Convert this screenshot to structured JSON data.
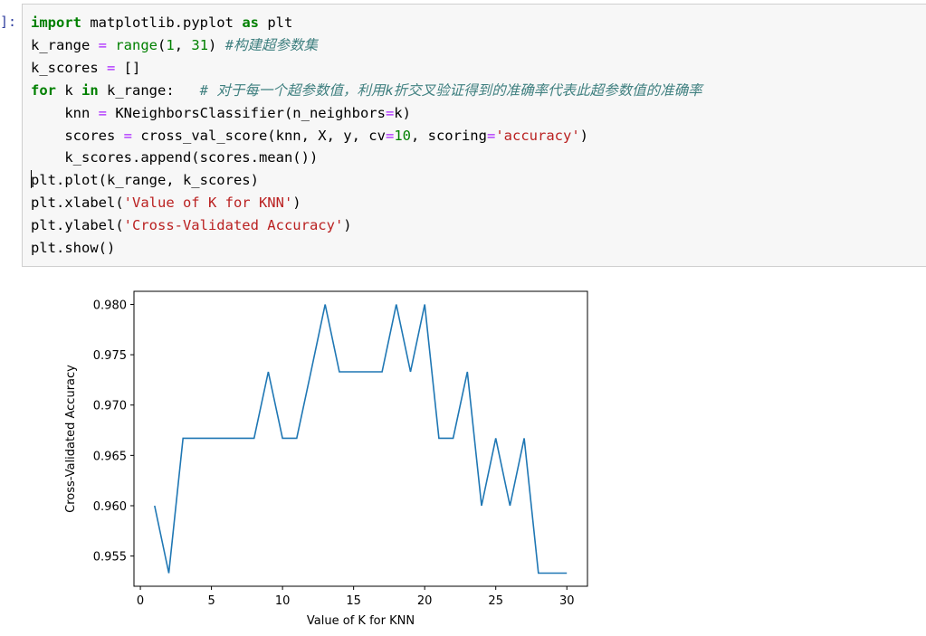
{
  "prompt": "]:",
  "code": {
    "lines": [
      [
        {
          "t": "import",
          "c": "kw"
        },
        {
          "t": " matplotlib.pyplot ",
          "c": ""
        },
        {
          "t": "as",
          "c": "kw"
        },
        {
          "t": " plt",
          "c": ""
        }
      ],
      [
        {
          "t": "k_range ",
          "c": ""
        },
        {
          "t": "=",
          "c": "op"
        },
        {
          "t": " ",
          "c": ""
        },
        {
          "t": "range",
          "c": "fn"
        },
        {
          "t": "(",
          "c": ""
        },
        {
          "t": "1",
          "c": "nu"
        },
        {
          "t": ", ",
          "c": ""
        },
        {
          "t": "31",
          "c": "nu"
        },
        {
          "t": ") ",
          "c": ""
        },
        {
          "t": "#构建超参数集",
          "c": "cm"
        }
      ],
      [
        {
          "t": "k_scores ",
          "c": ""
        },
        {
          "t": "=",
          "c": "op"
        },
        {
          "t": " []",
          "c": ""
        }
      ],
      [
        {
          "t": "for",
          "c": "kw"
        },
        {
          "t": " k ",
          "c": ""
        },
        {
          "t": "in",
          "c": "kw"
        },
        {
          "t": " k_range:   ",
          "c": ""
        },
        {
          "t": "# 对于每一个超参数值，利用k折交叉验证得到的准确率代表此超参数值的准确率",
          "c": "cm"
        }
      ],
      [
        {
          "t": "    knn ",
          "c": ""
        },
        {
          "t": "=",
          "c": "op"
        },
        {
          "t": " KNeighborsClassifier(n_neighbors",
          "c": ""
        },
        {
          "t": "=",
          "c": "op"
        },
        {
          "t": "k)",
          "c": ""
        }
      ],
      [
        {
          "t": "    scores ",
          "c": ""
        },
        {
          "t": "=",
          "c": "op"
        },
        {
          "t": " cross_val_score(knn, X, y, cv",
          "c": ""
        },
        {
          "t": "=",
          "c": "op"
        },
        {
          "t": "10",
          "c": "nu"
        },
        {
          "t": ", scoring",
          "c": ""
        },
        {
          "t": "=",
          "c": "op"
        },
        {
          "t": "'accuracy'",
          "c": "st"
        },
        {
          "t": ")",
          "c": ""
        }
      ],
      [
        {
          "t": "    k_scores.append(scores.mean())",
          "c": ""
        }
      ],
      [
        {
          "t": "plt.plot(k_range, k_scores)",
          "c": ""
        }
      ],
      [
        {
          "t": "plt.xlabel(",
          "c": ""
        },
        {
          "t": "'Value of K for KNN'",
          "c": "st"
        },
        {
          "t": ")",
          "c": ""
        }
      ],
      [
        {
          "t": "plt.ylabel(",
          "c": ""
        },
        {
          "t": "'Cross-Validated Accuracy'",
          "c": "st"
        },
        {
          "t": ")",
          "c": ""
        }
      ],
      [
        {
          "t": "plt.show()",
          "c": ""
        }
      ]
    ]
  },
  "colors": {
    "line": "#1f77b4",
    "keyword": "#008000",
    "comment": "#408080",
    "string": "#ba2121",
    "operator": "#aa22ff"
  },
  "chart_data": {
    "type": "line",
    "title": "",
    "xlabel": "Value of K for KNN",
    "ylabel": "Cross-Validated Accuracy",
    "x": [
      1,
      2,
      3,
      4,
      5,
      6,
      7,
      8,
      9,
      10,
      11,
      12,
      13,
      14,
      15,
      16,
      17,
      18,
      19,
      20,
      21,
      22,
      23,
      24,
      25,
      26,
      27,
      28,
      29,
      30
    ],
    "series": [
      {
        "values": [
          0.96,
          0.9533,
          0.9667,
          0.9667,
          0.9667,
          0.9667,
          0.9667,
          0.9667,
          0.9733,
          0.9667,
          0.9667,
          0.9733,
          0.98,
          0.9733,
          0.9733,
          0.9733,
          0.9733,
          0.98,
          0.9733,
          0.98,
          0.9667,
          0.9667,
          0.9733,
          0.96,
          0.9667,
          0.96,
          0.9667,
          0.9533,
          0.9533,
          0.9533
        ]
      }
    ],
    "xlim": [
      -0.45,
      31.45
    ],
    "ylim": [
      0.952,
      0.9813
    ],
    "xticks": [
      0,
      5,
      10,
      15,
      20,
      25,
      30
    ],
    "xtick_labels": [
      "0",
      "5",
      "10",
      "15",
      "20",
      "25",
      "30"
    ],
    "yticks": [
      0.955,
      0.96,
      0.965,
      0.97,
      0.975,
      0.98
    ],
    "ytick_labels": [
      "0.955",
      "0.960",
      "0.965",
      "0.970",
      "0.975",
      "0.980"
    ],
    "grid": false,
    "legend": "none"
  }
}
